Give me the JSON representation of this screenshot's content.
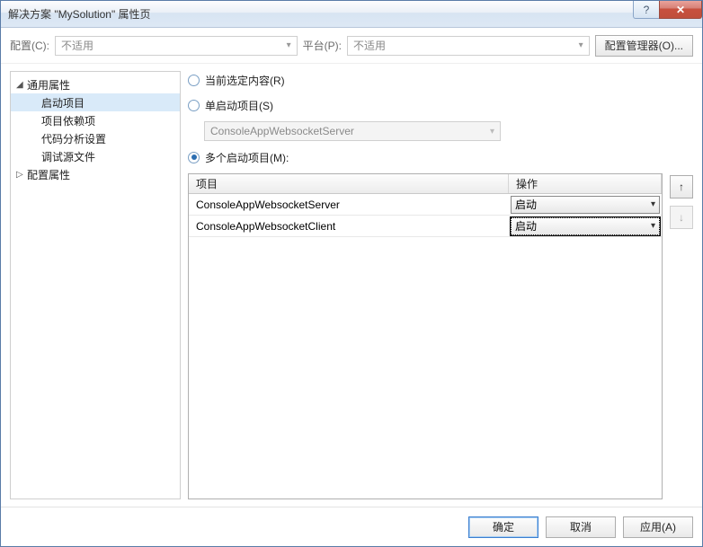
{
  "title": "解决方案 \"MySolution\" 属性页",
  "toprow": {
    "config_label": "配置(C):",
    "config_value": "不适用",
    "platform_label": "平台(P):",
    "platform_value": "不适用",
    "config_mgr": "配置管理器(O)..."
  },
  "tree": {
    "common": "通用属性",
    "startup": "启动项目",
    "deps": "项目依赖项",
    "analysis": "代码分析设置",
    "debug_src": "调试源文件",
    "config_props": "配置属性"
  },
  "startup": {
    "current": "当前选定内容(R)",
    "single": "单启动项目(S)",
    "single_value": "ConsoleAppWebsocketServer",
    "multi": "多个启动项目(M):",
    "col_project": "项目",
    "col_action": "操作",
    "rows": [
      {
        "project": "ConsoleAppWebsocketServer",
        "action": "启动"
      },
      {
        "project": "ConsoleAppWebsocketClient",
        "action": "启动"
      }
    ]
  },
  "footer": {
    "ok": "确定",
    "cancel": "取消",
    "apply": "应用(A)"
  }
}
